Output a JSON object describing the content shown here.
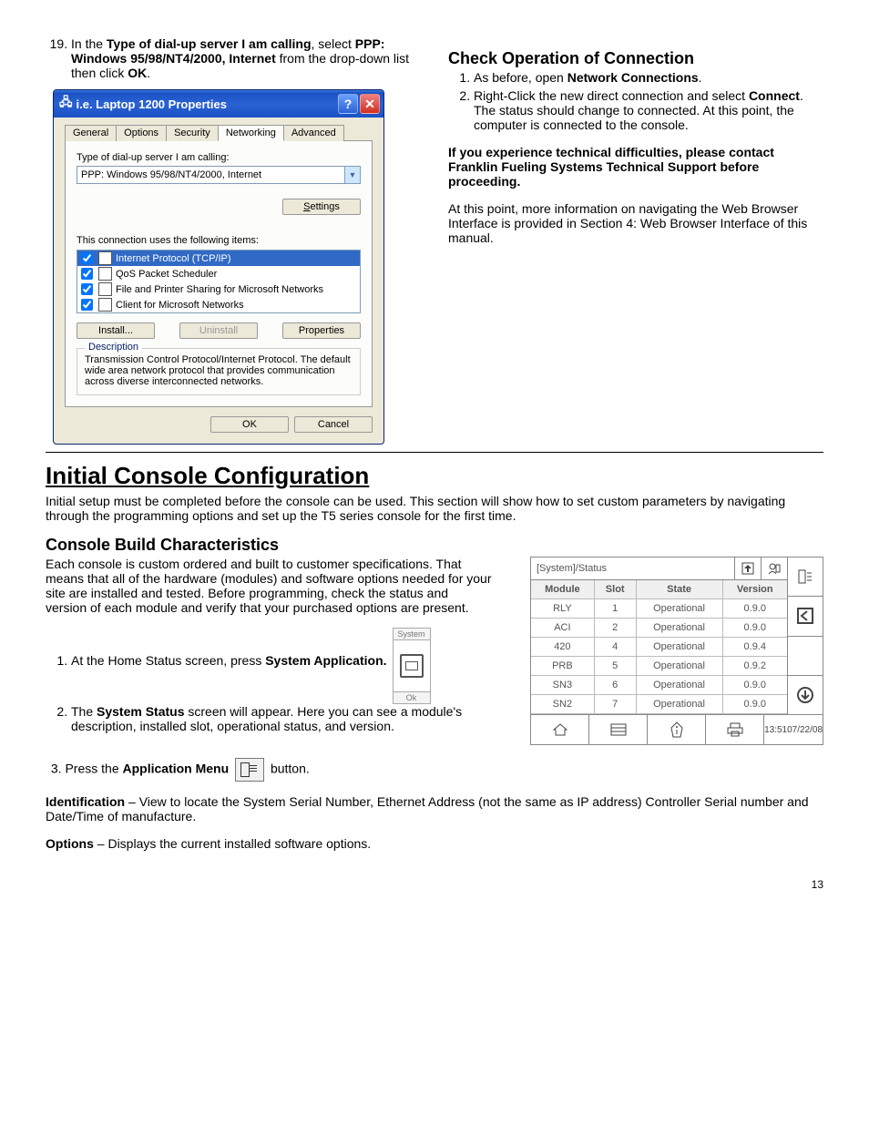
{
  "instructions_left": {
    "number": "19",
    "prefix": "In the ",
    "bold1": "Type of dial-up server I am calling",
    "mid": ", select ",
    "bold2": "PPP: Windows 95/98/NT4/2000, Internet",
    "mid2": " from the drop-down list then click ",
    "bold3": "OK",
    "suffix": "."
  },
  "dialog": {
    "title": "i.e.  Laptop 1200 Properties",
    "tabs": [
      "General",
      "Options",
      "Security",
      "Networking",
      "Advanced"
    ],
    "field_label": "Type of dial-up server I am calling:",
    "dropdown_value": "PPP: Windows 95/98/NT4/2000, Internet",
    "settings_btn": "Settings",
    "items_label": "This connection uses the following items:",
    "items": [
      "Internet Protocol (TCP/IP)",
      "QoS Packet Scheduler",
      "File and Printer Sharing for Microsoft Networks",
      "Client for Microsoft Networks"
    ],
    "install_btn": "Install...",
    "uninstall_btn": "Uninstall",
    "properties_btn": "Properties",
    "desc_legend": "Description",
    "desc_text": "Transmission Control Protocol/Internet Protocol. The default wide area network protocol that provides communication across diverse interconnected networks.",
    "ok_btn": "OK",
    "cancel_btn": "Cancel"
  },
  "check_op": {
    "title": "Check Operation of Connection",
    "step1_pre": "As before, open ",
    "step1_bold": "Network Connections",
    "step1_post": ".",
    "step2_pre": "Right-Click the new direct connection and select ",
    "step2_bold": "Connect",
    "step2_post": ". The status should change to connected. At this point, the computer is connected to the console.",
    "warn": "If you experience technical difficulties, please contact Franklin Fueling Systems Technical Support before proceeding.",
    "para": "At this point, more information on navigating the Web Browser Interface is provided in Section 4: Web Browser Interface of this manual."
  },
  "init_config": {
    "title": "Initial Console Configuration",
    "para": "Initial setup must be completed before the console can be used. This section will show how to set custom parameters by navigating through the programming options and set up the T5 series console for the first time."
  },
  "console_build": {
    "title": "Console Build Characteristics",
    "para": "Each console is custom ordered and built to customer specifications. That means that all of the hardware (modules) and software options needed for your site are installed and tested. Before programming, check the status and version of each module and verify that your purchased options are present.",
    "step1_pre": "At the Home Status screen, press ",
    "step1_bold": "System Application.",
    "step2_pre": "The ",
    "step2_bold": "System Status",
    "step2_post": " screen will appear. Here you can see a module's description, installed slot, operational status, and version.",
    "step3_pre": "Press the ",
    "step3_bold": "Application Menu",
    "step3_post": " button.",
    "sys_top": "System",
    "sys_bot": "Ok",
    "ident_bold": "Identification",
    "ident_text": " – View to locate the System Serial Number, Ethernet Address (not the same as IP address) Controller Serial number and Date/Time of manufacture.",
    "opt_bold": "Options",
    "opt_text": " – Displays the current installed software options."
  },
  "status": {
    "breadcrumb": "[System]/Status",
    "headers": [
      "Module",
      "Slot",
      "State",
      "Version"
    ],
    "rows": [
      [
        "RLY",
        "1",
        "Operational",
        "0.9.0"
      ],
      [
        "ACI",
        "2",
        "Operational",
        "0.9.0"
      ],
      [
        "420",
        "4",
        "Operational",
        "0.9.4"
      ],
      [
        "PRB",
        "5",
        "Operational",
        "0.9.2"
      ],
      [
        "SN3",
        "6",
        "Operational",
        "0.9.0"
      ],
      [
        "SN2",
        "7",
        "Operational",
        "0.9.0"
      ]
    ],
    "time": "13:51",
    "date": "07/22/08"
  },
  "page_num": "13"
}
